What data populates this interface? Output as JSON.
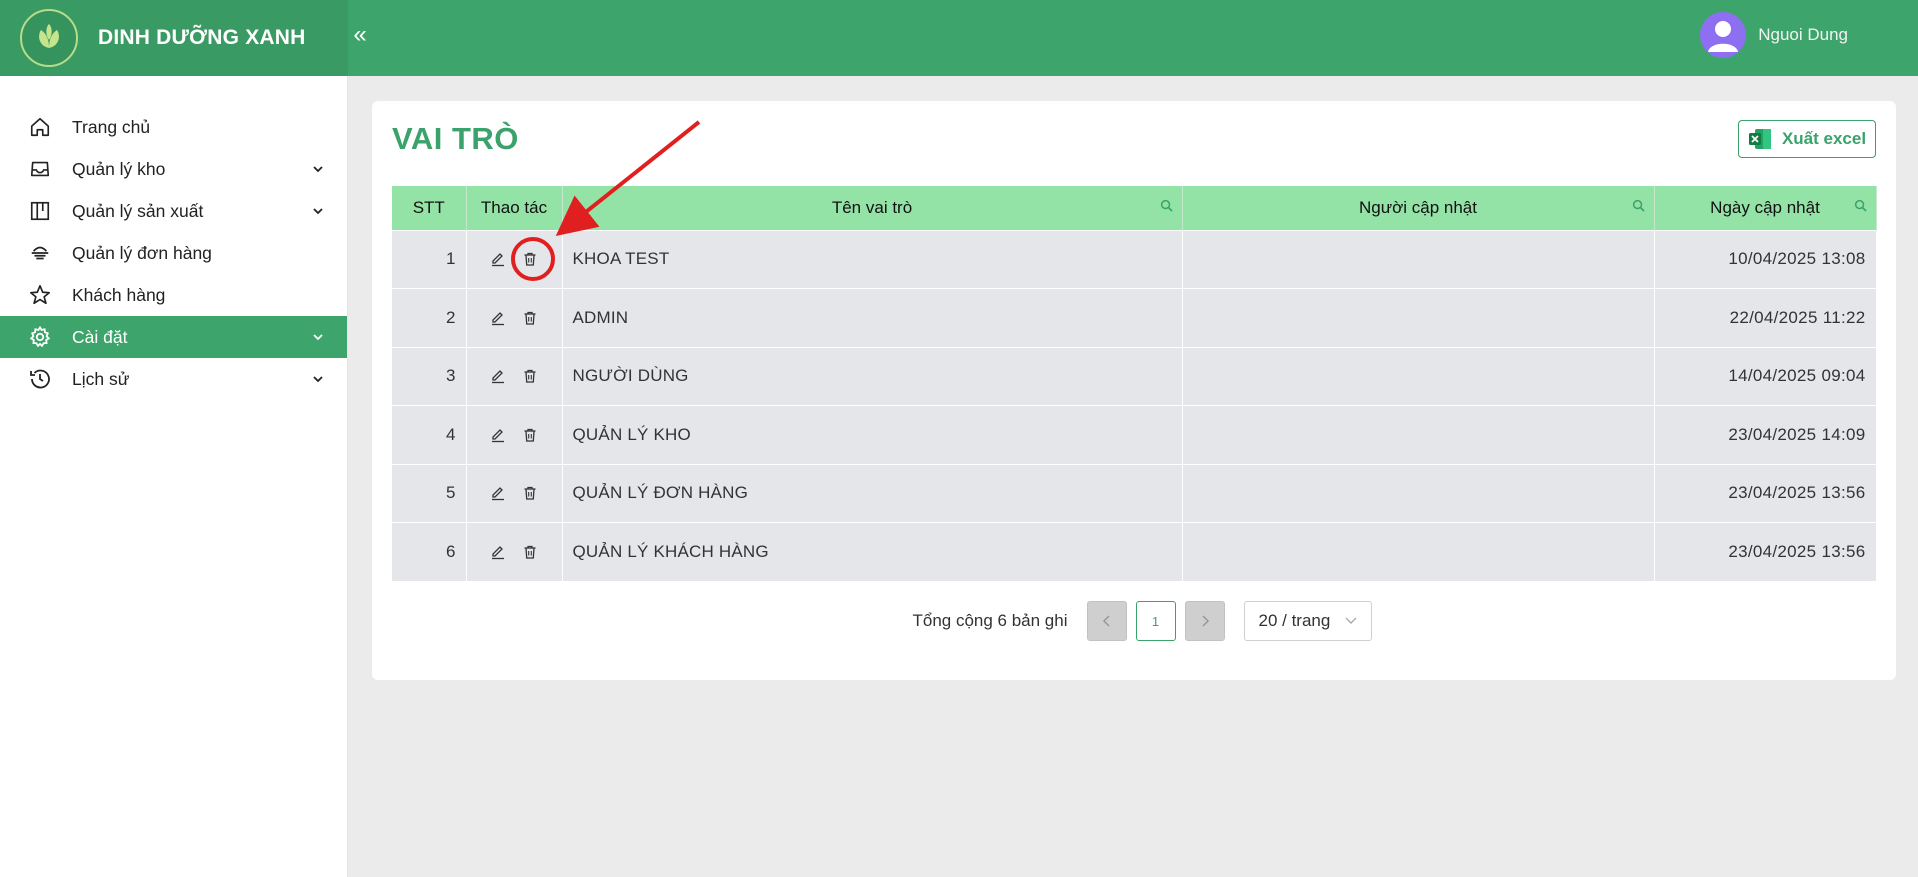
{
  "header": {
    "brand": "DINH DƯỠNG XANH",
    "collapse_icon": "«",
    "user_name": "Nguoi Dung"
  },
  "sidebar": {
    "items": [
      {
        "label": "Trang chủ",
        "icon": "home-icon",
        "has_submenu": false
      },
      {
        "label": "Quản lý kho",
        "icon": "inbox-icon",
        "has_submenu": true
      },
      {
        "label": "Quản lý sản xuất",
        "icon": "production-board-icon",
        "has_submenu": true
      },
      {
        "label": "Quản lý đơn hàng",
        "icon": "delivery-icon",
        "has_submenu": false
      },
      {
        "label": "Khách hàng",
        "icon": "star-icon",
        "has_submenu": false
      },
      {
        "label": "Cài đặt",
        "icon": "gear-icon",
        "has_submenu": true,
        "active": true
      },
      {
        "label": "Lịch sử",
        "icon": "history-clock-icon",
        "has_submenu": true
      }
    ]
  },
  "main": {
    "title": "VAI TRÒ",
    "export_label": "Xuất excel",
    "table": {
      "columns": [
        "STT",
        "Thao tác",
        "Tên vai trò",
        "Người cập nhật",
        "Ngày cập nhật"
      ],
      "rows": [
        {
          "stt": "1",
          "name": "KHOA TEST",
          "updated_by": "",
          "updated_at": "10/04/2025 13:08"
        },
        {
          "stt": "2",
          "name": "ADMIN",
          "updated_by": "",
          "updated_at": "22/04/2025 11:22"
        },
        {
          "stt": "3",
          "name": "NGƯỜI DÙNG",
          "updated_by": "",
          "updated_at": "14/04/2025 09:04"
        },
        {
          "stt": "4",
          "name": "QUẢN LÝ KHO",
          "updated_by": "",
          "updated_at": "23/04/2025 14:09"
        },
        {
          "stt": "5",
          "name": "QUẢN LÝ ĐƠN HÀNG",
          "updated_by": "",
          "updated_at": "23/04/2025 13:56"
        },
        {
          "stt": "6",
          "name": "QUẢN LÝ KHÁCH HÀNG",
          "updated_by": "",
          "updated_at": "23/04/2025 13:56"
        }
      ]
    },
    "pagination": {
      "total_text": "Tổng cộng 6 bản ghi",
      "current_page": "1",
      "page_size_label": "20 / trang"
    }
  },
  "colors": {
    "primary": "#3da56b",
    "table_header": "#93e2a6",
    "row_bg": "#e5e6ea",
    "annotation": "#e02020"
  }
}
